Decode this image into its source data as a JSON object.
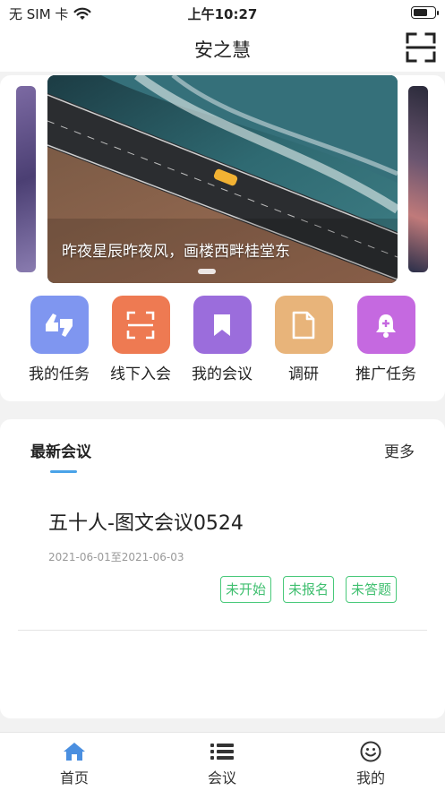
{
  "status_bar": {
    "carrier": "无 SIM 卡",
    "time": "上午10:27",
    "battery_level": 0.7
  },
  "nav": {
    "title": "安之慧",
    "scan_icon": "scan-icon"
  },
  "banner": {
    "caption": "昨夜星辰昨夜风，画楼西畔桂堂东",
    "active_index": 0
  },
  "quick_menu": [
    {
      "label": "我的任务",
      "icon": "thumbs-icon",
      "color": "#7f96f0"
    },
    {
      "label": "线下入会",
      "icon": "scan-frame-icon",
      "color": "#ee7a52"
    },
    {
      "label": "我的会议",
      "icon": "bookmark-icon",
      "color": "#9b6ddc"
    },
    {
      "label": "调研",
      "icon": "document-icon",
      "color": "#e8b47a"
    },
    {
      "label": "推广任务",
      "icon": "bell-plus-icon",
      "color": "#c569e0"
    }
  ],
  "meetings_section": {
    "title": "最新会议",
    "more": "更多",
    "accent_color": "#4aa3e8",
    "items": [
      {
        "title": "五十人-图文会议0524",
        "date": "2021-06-01至2021-06-03",
        "tags": [
          "未开始",
          "未报名",
          "未答题"
        ]
      }
    ]
  },
  "tab_bar": {
    "active_color": "#4a8fe0",
    "tabs": [
      {
        "label": "首页",
        "icon": "home-icon",
        "active": true
      },
      {
        "label": "会议",
        "icon": "list-icon",
        "active": false
      },
      {
        "label": "我的",
        "icon": "smile-icon",
        "active": false
      }
    ]
  }
}
